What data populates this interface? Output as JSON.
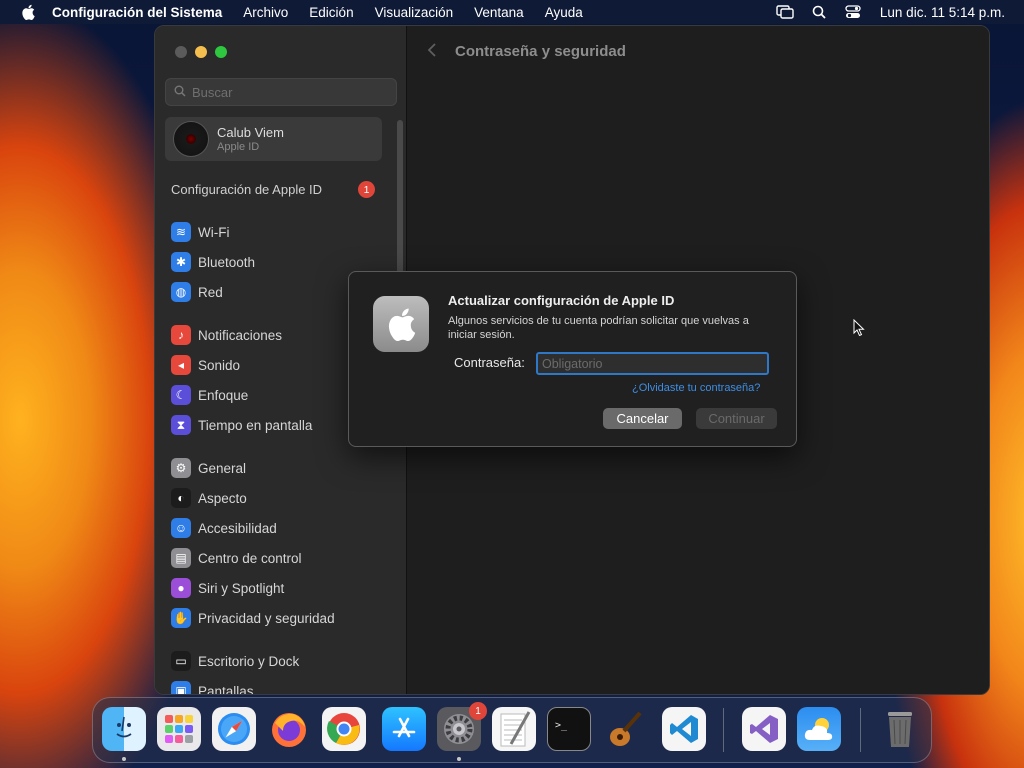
{
  "menubar": {
    "app_name": "Configuración del Sistema",
    "items": [
      "Archivo",
      "Edición",
      "Visualización",
      "Ventana",
      "Ayuda"
    ],
    "clock": "Lun dic. 11  5:14 p.m."
  },
  "sidebar": {
    "search_placeholder": "Buscar",
    "account": {
      "name": "Calub Viem",
      "subtitle": "Apple ID"
    },
    "apple_id_settings": {
      "label": "Configuración de Apple ID",
      "badge": "1"
    },
    "items": [
      {
        "label": "Wi-Fi",
        "icon": "wifi-icon",
        "color": "#2f7ee8"
      },
      {
        "label": "Bluetooth",
        "icon": "bluetooth-icon",
        "color": "#2f7ee8"
      },
      {
        "label": "Red",
        "icon": "globe-icon",
        "color": "#2f7ee8"
      },
      {
        "label": "Notificaciones",
        "icon": "bell-icon",
        "color": "#e6483c"
      },
      {
        "label": "Sonido",
        "icon": "speaker-icon",
        "color": "#e6483c"
      },
      {
        "label": "Enfoque",
        "icon": "moon-icon",
        "color": "#5b4fd9"
      },
      {
        "label": "Tiempo en pantalla",
        "icon": "hourglass-icon",
        "color": "#5b4fd9"
      },
      {
        "label": "General",
        "icon": "gear-icon",
        "color": "#8e8e93"
      },
      {
        "label": "Aspecto",
        "icon": "appearance-icon",
        "color": "#1c1c1c"
      },
      {
        "label": "Accesibilidad",
        "icon": "accessibility-icon",
        "color": "#2f7ee8"
      },
      {
        "label": "Centro de control",
        "icon": "control-center-icon",
        "color": "#8e8e93"
      },
      {
        "label": "Siri y Spotlight",
        "icon": "siri-icon",
        "color": "#9b4fd9"
      },
      {
        "label": "Privacidad y seguridad",
        "icon": "hand-icon",
        "color": "#2f7ee8"
      },
      {
        "label": "Escritorio y Dock",
        "icon": "dock-icon",
        "color": "#1c1c1c"
      },
      {
        "label": "Pantallas",
        "icon": "display-icon",
        "color": "#2f7ee8"
      }
    ]
  },
  "content": {
    "title": "Contraseña y seguridad"
  },
  "dialog": {
    "title": "Actualizar configuración de Apple ID",
    "message": "Algunos servicios de tu cuenta podrían solicitar que vuelvas a iniciar sesión.",
    "password_label": "Contraseña:",
    "password_placeholder": "Obligatorio",
    "password_value": "",
    "forgot_link": "¿Olvidaste tu contraseña?",
    "cancel_label": "Cancelar",
    "continue_label": "Continuar"
  },
  "dock": {
    "apps": [
      "Finder",
      "Launchpad",
      "Safari",
      "Firefox",
      "Chrome",
      "App Store",
      "Configuración del Sistema",
      "TextEdit",
      "Terminal",
      "GarageBand",
      "Visual Studio Code",
      "Visual Studio",
      "Tiempo",
      "Papelera"
    ],
    "system_settings_badge": "1"
  },
  "colors": {
    "accent": "#2e78c7",
    "badge": "#e0453a",
    "link": "#3d8ee5"
  }
}
